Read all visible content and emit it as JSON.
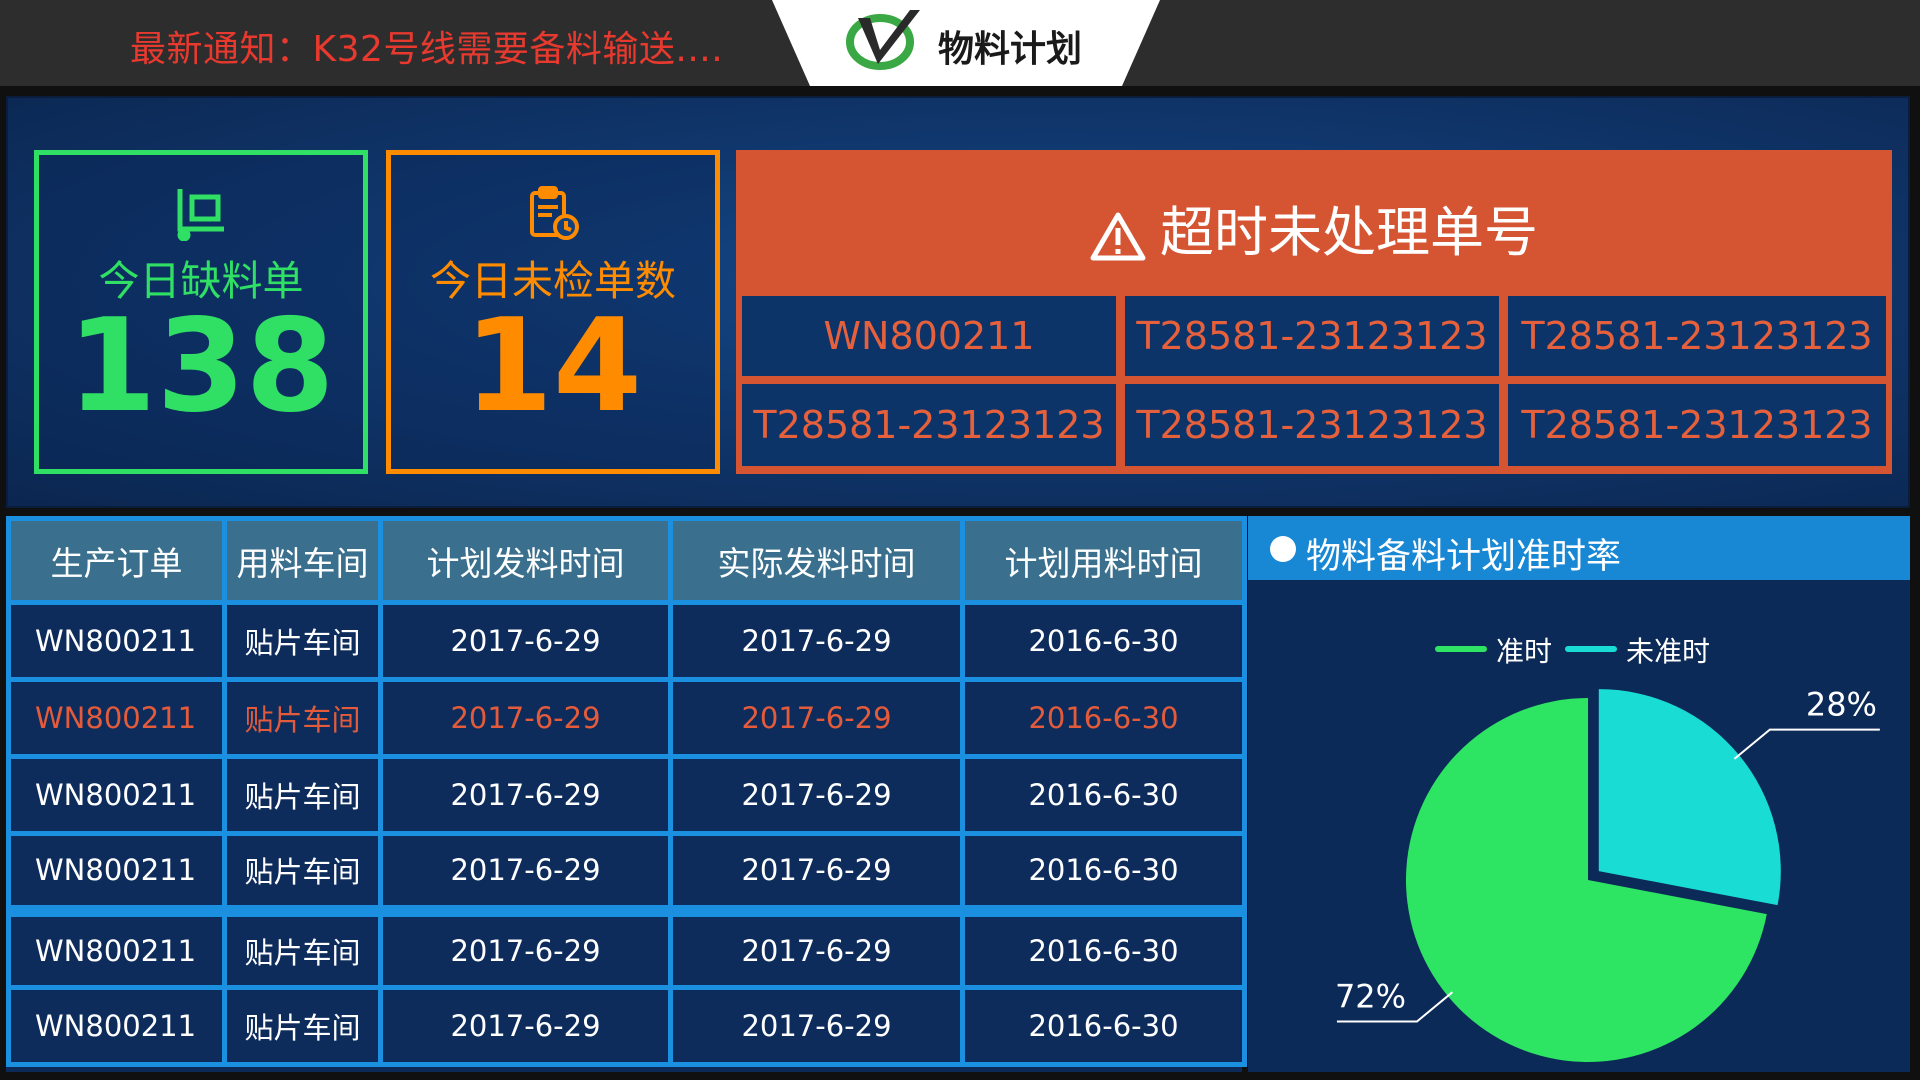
{
  "topbar": {
    "notice": "最新通知：K32号线需要备料输送....",
    "brand_title": "物料计划"
  },
  "kpis": {
    "shortage": {
      "label": "今日缺料单",
      "value": "138",
      "icon": "cart-icon",
      "color": "#2fe064"
    },
    "uninspected": {
      "label": "今日未检单数",
      "value": "14",
      "icon": "clipboard-clock-icon",
      "color": "#ff8c00"
    }
  },
  "overdue": {
    "title": "超时未处理单号",
    "icon": "warning-icon",
    "orders": [
      "WN800211",
      "T28581-23123123",
      "T28581-23123123",
      "T28581-23123123",
      "T28581-23123123",
      "T28581-23123123"
    ]
  },
  "table": {
    "headers": [
      "生产订单",
      "用料车间",
      "计划发料时间",
      "实际发料时间",
      "计划用料时间"
    ],
    "rows": [
      [
        "WN800211",
        "贴片车间",
        "2017-6-29",
        "2017-6-29",
        "2016-6-30"
      ],
      [
        "WN800211",
        "贴片车间",
        "2017-6-29",
        "2017-6-29",
        "2016-6-30"
      ],
      [
        "WN800211",
        "贴片车间",
        "2017-6-29",
        "2017-6-29",
        "2016-6-30"
      ],
      [
        "WN800211",
        "贴片车间",
        "2017-6-29",
        "2017-6-29",
        "2016-6-30"
      ],
      [
        "WN800211",
        "贴片车间",
        "2017-6-29",
        "2017-6-29",
        "2016-6-30"
      ],
      [
        "WN800211",
        "贴片车间",
        "2017-6-29",
        "2017-6-29",
        "2016-6-30"
      ]
    ],
    "alert_row_index": 1
  },
  "chart_panel": {
    "title": "物料备料计划准时率"
  },
  "chart_data": {
    "type": "pie",
    "title": "物料备料计划准时率",
    "legend_position": "top",
    "slices": [
      {
        "name": "准时",
        "value": 72,
        "label": "72%",
        "color": "#2de563"
      },
      {
        "name": "未准时",
        "value": 28,
        "label": "28%",
        "color": "#19ddd4"
      }
    ]
  }
}
